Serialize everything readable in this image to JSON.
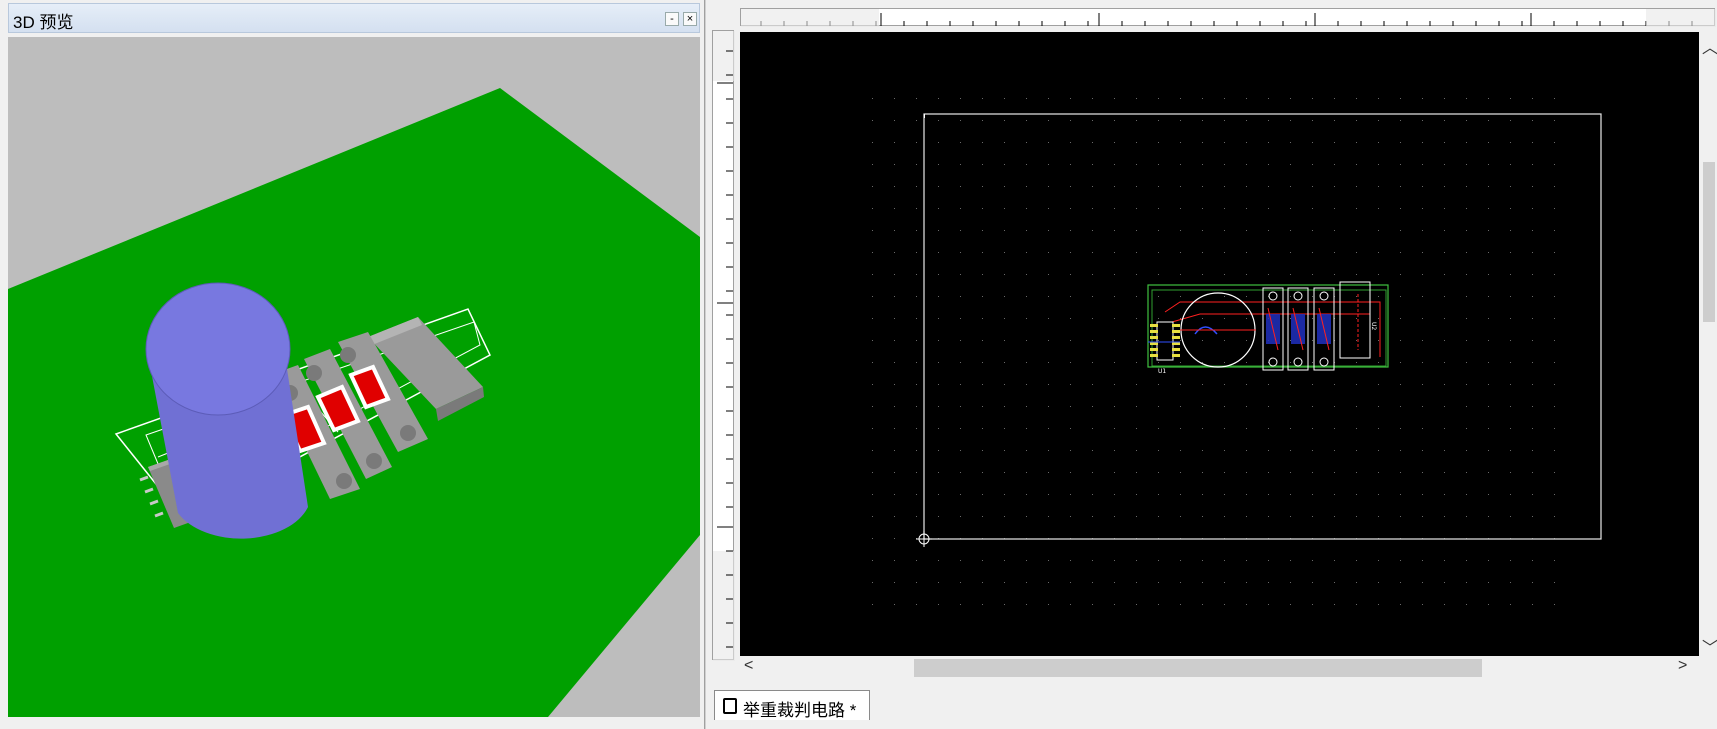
{
  "panel": {
    "title": "3D 预览",
    "minimize_label": "-",
    "close_label": "×"
  },
  "document_tab": {
    "label": "举重裁判电路 *"
  },
  "board_labels": {
    "u1": "U1",
    "u2": "U2"
  },
  "colors": {
    "board_green": "#00a000",
    "capacitor_blue": "#7878d8",
    "pad_red": "#e00000",
    "silkscreen": "#ffffff",
    "pcb_background": "#000000",
    "board_outline": "#e8e8e8",
    "trace_red": "#ff2020",
    "trace_blue": "#3050ff",
    "outline_green": "#40c040",
    "pad_yellow": "#e8e040"
  },
  "icons": {
    "scroll_left": "chevron-left-icon",
    "scroll_right": "chevron-right-icon",
    "tab": "chip-icon"
  }
}
